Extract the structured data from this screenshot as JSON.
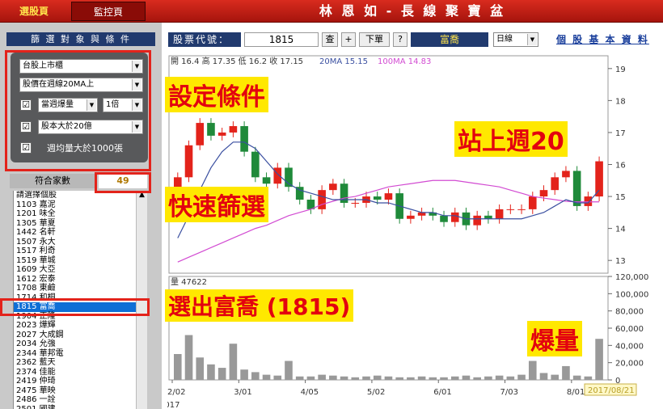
{
  "topbar": {
    "tab_select": "選股頁",
    "tab_monitor": "監控頁",
    "title": "林 恩 如 - 長 線 聚 寶 盆"
  },
  "left": {
    "header": "篩 選 對 象 與 條 件",
    "market": "台股上市櫃",
    "price_cond": "股價在週線20MA上",
    "vol_cond": "當週爆量",
    "vol_mult": "1倍",
    "cap_cond": "股本大於20億",
    "avgvol_cond": "週均量大於1000張",
    "match_label": "符合家數",
    "match_count": "49",
    "list": [
      "請選擇個股",
      "1103 嘉泥",
      "1201 味全",
      "1305 華夏",
      "1442 名軒",
      "1507 永大",
      "1517 利奇",
      "1519 華城",
      "1609 大亞",
      "1612 宏泰",
      "1708 東鹼",
      "1714 和桐",
      "1815 富喬",
      "1904 正隆",
      "2023 燁輝",
      "2027 大成鋼",
      "2034 允強",
      "2344 華邦電",
      "2362 藍天",
      "2374 佳能",
      "2419 仲琦",
      "2475 華映",
      "2486 一詮",
      "2501 國建"
    ],
    "selected_index": 12
  },
  "toolbar": {
    "code_label": "股票代號：",
    "code": "1815",
    "btn_query": "查",
    "btn_add": "+",
    "btn_order": "下單",
    "btn_help": "?",
    "stock_name": "富喬",
    "period": "日線",
    "info_link": "個 股 基 本 資 料"
  },
  "quote": {
    "text": "開 16.4  高 17.35  低 16.2  收 17.15",
    "ma20": "20MA 15.15",
    "ma100": "100MA 14.83"
  },
  "volume": {
    "text": "量 47622"
  },
  "date_tag": "2017/08/21",
  "annotations": {
    "a1": "設定條件",
    "a2": "快速篩選",
    "a3": "選出富喬 (1815)",
    "a4": "站上週20",
    "a5": "爆量"
  },
  "chart_data": {
    "type": "candlestick",
    "x": [
      "2/02",
      "3/01",
      "4/05",
      "5/02",
      "6/01",
      "7/03",
      "8/01"
    ],
    "year": "2017",
    "price_ticks": [
      13,
      14,
      15,
      16,
      17,
      18,
      19
    ],
    "ylim_price": [
      12.6,
      19.4
    ],
    "vol_ticks": [
      "0",
      "20,000",
      "40,000",
      "60,000",
      "80,000",
      "100,000",
      "120,000"
    ],
    "ylim_volume": [
      0,
      120000
    ],
    "close": [
      15.6,
      16.6,
      17.3,
      16.9,
      17.0,
      17.2,
      16.4,
      15.6,
      15.4,
      15.9,
      15.3,
      14.9,
      14.6,
      15.2,
      15.4,
      14.8,
      14.8,
      15.0,
      14.9,
      15.1,
      14.3,
      14.4,
      14.5,
      14.4,
      14.2,
      14.5,
      14.1,
      14.4,
      14.3,
      14.6,
      14.6,
      14.6,
      15.0,
      15.2,
      15.6,
      15.8,
      14.7,
      15.0,
      16.1
    ],
    "ma20": [
      13.7,
      14.4,
      15.2,
      15.9,
      16.4,
      16.7,
      16.7,
      16.5,
      16.1,
      15.7,
      15.4,
      15.2,
      15.1,
      15.0,
      14.9,
      14.9,
      14.9,
      14.9,
      14.8,
      14.8,
      14.7,
      14.6,
      14.5,
      14.5,
      14.4,
      14.4,
      14.3,
      14.3,
      14.3,
      14.3,
      14.3,
      14.3,
      14.4,
      14.5,
      14.7,
      14.9,
      14.8,
      14.8,
      15.2
    ],
    "ma100": [
      12.95,
      13.1,
      13.25,
      13.4,
      13.55,
      13.7,
      13.85,
      14.0,
      14.1,
      14.25,
      14.4,
      14.5,
      14.6,
      14.75,
      14.85,
      14.95,
      15.0,
      15.1,
      15.2,
      15.3,
      15.35,
      15.4,
      15.45,
      15.5,
      15.5,
      15.5,
      15.45,
      15.4,
      15.35,
      15.3,
      15.2,
      15.1,
      15.0,
      14.95,
      14.9,
      14.85,
      14.83,
      14.83,
      14.83
    ],
    "volume": [
      30000,
      52000,
      26000,
      18000,
      14000,
      42000,
      12000,
      9000,
      6000,
      5000,
      22000,
      4000,
      4000,
      6000,
      5000,
      4000,
      3000,
      4000,
      5000,
      4000,
      3000,
      3000,
      4000,
      3000,
      3000,
      4000,
      5000,
      3000,
      4000,
      5000,
      4000,
      6000,
      22000,
      8000,
      6000,
      16000,
      5000,
      4000,
      47622
    ]
  }
}
